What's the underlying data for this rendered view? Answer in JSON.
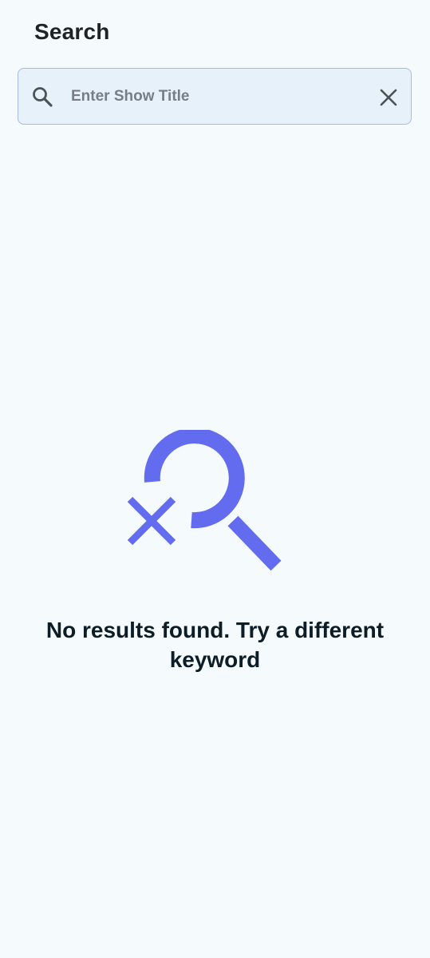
{
  "header": {
    "title": "Search"
  },
  "search": {
    "value": "",
    "placeholder": "Enter Show Title",
    "leading_icon": "search-icon",
    "trailing_icon": "close-icon"
  },
  "empty_state": {
    "icon": "search-no-results-icon",
    "message": "No results found. Try a different keyword"
  },
  "colors": {
    "background": "#f5fbfd",
    "search_field_bg": "#e6f1f9",
    "search_field_border": "#a7b9ea",
    "accent": "#636bef",
    "message_text": "#0c1d27"
  }
}
